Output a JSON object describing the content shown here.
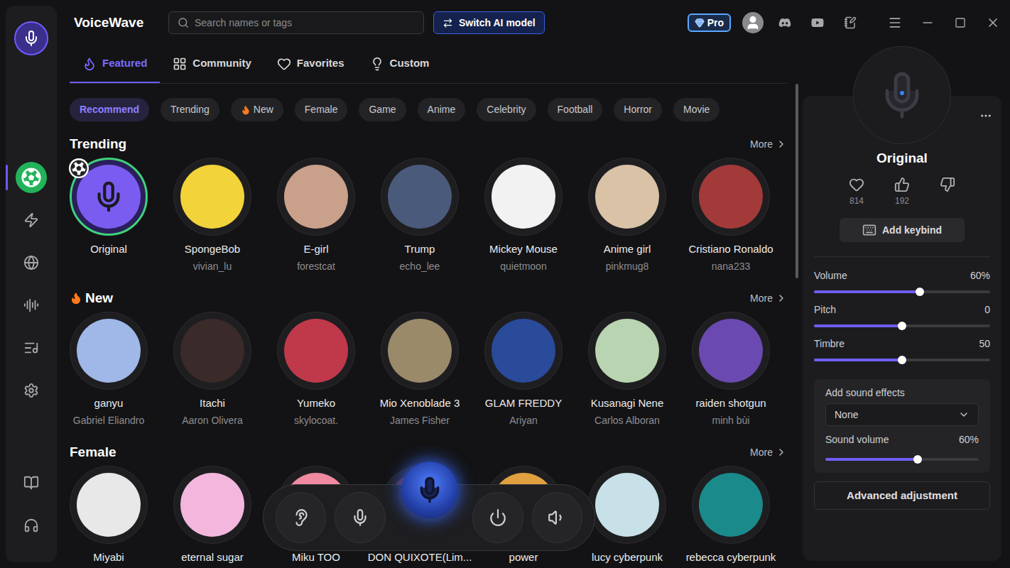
{
  "app": {
    "title": "VoiceWave",
    "pro_badge": "Pro"
  },
  "search": {
    "placeholder": "Search names or tags"
  },
  "switch_button": "Switch AI model",
  "sidebar": {
    "items": [
      {
        "selected": true
      },
      {
        "selected": false
      },
      {
        "selected": false
      },
      {
        "selected": false
      },
      {
        "selected": false
      },
      {
        "selected": false
      }
    ],
    "footer_items": [
      {
        "selected": false
      },
      {
        "selected": false
      }
    ]
  },
  "tabs": [
    {
      "label": "Featured",
      "selected": true
    },
    {
      "label": "Community",
      "selected": false
    },
    {
      "label": "Favorites",
      "selected": false
    },
    {
      "label": "Custom",
      "selected": false
    }
  ],
  "chips": [
    {
      "label": "Recommend",
      "selected": true,
      "hot": false
    },
    {
      "label": "Trending",
      "selected": false,
      "hot": false
    },
    {
      "label": "New",
      "selected": false,
      "hot": true
    },
    {
      "label": "Female",
      "selected": false,
      "hot": false
    },
    {
      "label": "Game",
      "selected": false,
      "hot": false
    },
    {
      "label": "Anime",
      "selected": false,
      "hot": false
    },
    {
      "label": "Celebrity",
      "selected": false,
      "hot": false
    },
    {
      "label": "Football",
      "selected": false,
      "hot": false
    },
    {
      "label": "Horror",
      "selected": false,
      "hot": false
    },
    {
      "label": "Movie",
      "selected": false,
      "hot": false
    }
  ],
  "sections": [
    {
      "title": "Trending",
      "hot": false,
      "more": "More",
      "items": [
        {
          "name": "Original",
          "selected": true
        },
        {
          "name": "SpongeBob",
          "author": "vivian_lu",
          "selected": false
        },
        {
          "name": "E-girl",
          "author": "forestcat",
          "selected": false
        },
        {
          "name": "Trump",
          "author": "echo_lee",
          "selected": false
        },
        {
          "name": "Mickey Mouse",
          "author": "quietmoon",
          "selected": false
        },
        {
          "name": "Anime girl",
          "author": "pinkmug8",
          "selected": false
        },
        {
          "name": "Cristiano Ronaldo",
          "author": "nana233",
          "selected": false
        }
      ]
    },
    {
      "title": "New",
      "hot": true,
      "more": "More",
      "items": [
        {
          "name": "ganyu",
          "author": "Gabriel Eliandro",
          "selected": false
        },
        {
          "name": "Itachi",
          "author": "Aaron Olivera",
          "selected": false
        },
        {
          "name": "Yumeko",
          "author": "skylocoat.",
          "selected": false
        },
        {
          "name": "Mio Xenoblade 3",
          "author": "James Fisher",
          "selected": false
        },
        {
          "name": "GLAM FREDDY",
          "author": "Ariyan",
          "selected": false
        },
        {
          "name": "Kusanagi Nene",
          "author": "Carlos Alboran",
          "selected": false
        },
        {
          "name": "raiden shotgun",
          "author": "minh bùi",
          "selected": false
        }
      ]
    },
    {
      "title": "Female",
      "hot": false,
      "more": "More",
      "items": [
        {
          "name": "Miyabi",
          "selected": false
        },
        {
          "name": "eternal sugar",
          "selected": false
        },
        {
          "name": "Miku TOO",
          "selected": false
        },
        {
          "name": "DON QUIXOTE(Lim...",
          "selected": false
        },
        {
          "name": "power",
          "selected": false
        },
        {
          "name": "lucy cyberpunk",
          "selected": false
        },
        {
          "name": "rebecca cyberpunk",
          "selected": false
        }
      ]
    }
  ],
  "panel": {
    "title": "Original",
    "likes": "814",
    "upvotes": "192",
    "keybind": "Add keybind",
    "sliders": [
      {
        "label": "Volume",
        "value": "60%",
        "level": 0.6
      },
      {
        "label": "Pitch",
        "value": "0",
        "level": 0.5
      },
      {
        "label": "Timbre",
        "value": "50",
        "level": 0.5
      }
    ],
    "effects": {
      "label": "Add sound effects",
      "selected": "None",
      "volume_label": "Sound volume",
      "volume_value": "60%",
      "level": 0.6
    },
    "advanced": "Advanced adjustment"
  }
}
